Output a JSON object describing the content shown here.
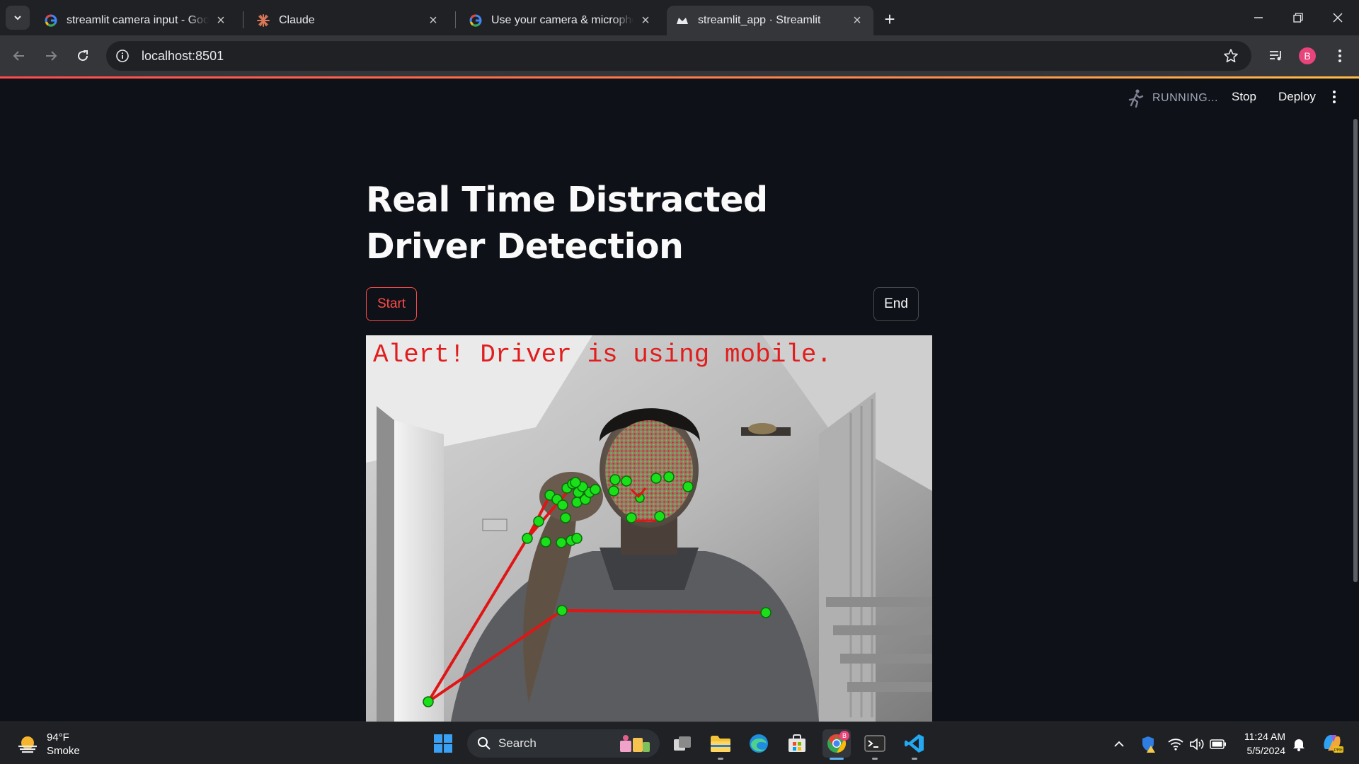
{
  "browser": {
    "tabs": [
      {
        "title": "streamlit camera input - Google",
        "favicon": "google-icon",
        "active": false
      },
      {
        "title": "Claude",
        "favicon": "claude-icon",
        "active": false
      },
      {
        "title": "Use your camera & microphone",
        "favicon": "google-icon",
        "active": false
      },
      {
        "title": "streamlit_app · Streamlit",
        "favicon": "streamlit-icon",
        "active": true
      }
    ],
    "url": "localhost:8501",
    "profile_initial": "B"
  },
  "streamlit": {
    "status": "RUNNING...",
    "stop_label": "Stop",
    "deploy_label": "Deploy",
    "title": "Real Time Distracted Driver Detection",
    "start_label": "Start",
    "end_label": "End",
    "accent_color": "#ff4b4b",
    "video": {
      "alert_text": "Alert! Driver is using mobile.",
      "alert_color": "#e11d1d",
      "landmark_color": "#22e01a"
    }
  },
  "taskbar": {
    "weather_temp": "94°F",
    "weather_desc": "Smoke",
    "search_placeholder": "Search",
    "time": "11:24 AM",
    "date": "5/5/2024",
    "chrome_badge": "B"
  }
}
